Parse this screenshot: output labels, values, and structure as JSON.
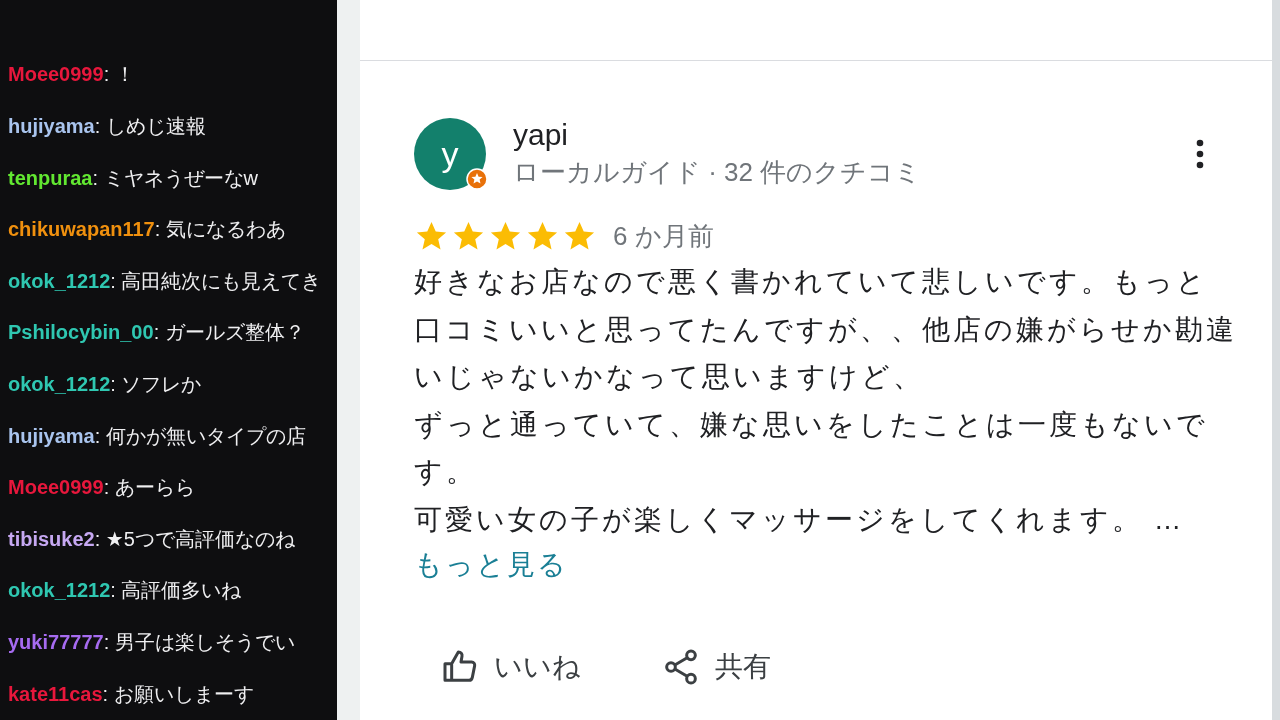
{
  "chat": {
    "messages": [
      {
        "user": "Moee0999",
        "color": "#e8173c",
        "text": ": ！"
      },
      {
        "user": "hujiyama",
        "color": "#a9c4ee",
        "text": ": しめじ速報"
      },
      {
        "user": "tenpuraa",
        "color": "#62e831",
        "text": ": ミヤネうぜーなw"
      },
      {
        "user": "chikuwapan117",
        "color": "#f0900e",
        "text": ": 気になるわあ"
      },
      {
        "user": "okok_1212",
        "color": "#2fc7b1",
        "text": ": 高田純次にも見えてき"
      },
      {
        "user": "Pshilocybin_00",
        "color": "#2fc7b1",
        "text": ": ガールズ整体？"
      },
      {
        "user": "okok_1212",
        "color": "#2fc7b1",
        "text": ": ソフレか"
      },
      {
        "user": "hujiyama",
        "color": "#a9c4ee",
        "text": ": 何かが無いタイプの店"
      },
      {
        "user": "Moee0999",
        "color": "#e8173c",
        "text": ": あーらら"
      },
      {
        "user": "tibisuke2",
        "color": "#c6a8f2",
        "text": ": ★5つで高評価なのね"
      },
      {
        "user": "okok_1212",
        "color": "#2fc7b1",
        "text": ": 高評価多いね"
      },
      {
        "user": "yuki77777",
        "color": "#a66bf0",
        "text": ": 男子は楽しそうでい"
      },
      {
        "user": "kate11cas",
        "color": "#e8173c",
        "text": ": お願いしまーす"
      }
    ]
  },
  "review": {
    "avatar_letter": "y",
    "author": "yapi",
    "subtitle": "ローカルガイド · 32 件のクチコミ",
    "stars": 5,
    "time": "6 か月前",
    "lines": [
      "好きなお店なので悪く書かれていて悲しいです。もっと",
      "口コミいいと思ってたんですが、、他店の嫌がらせか勘違",
      "いじゃないかなって思いますけど、",
      "ずっと通っていて、嫌な思いをしたことは一度もないで",
      "す。",
      "可愛い女の子が楽しくマッサージをしてくれます。 …"
    ],
    "more_link": "もっと見る",
    "actions": [
      {
        "kind": "like",
        "label": "いいね"
      },
      {
        "kind": "share",
        "label": "共有"
      }
    ]
  }
}
